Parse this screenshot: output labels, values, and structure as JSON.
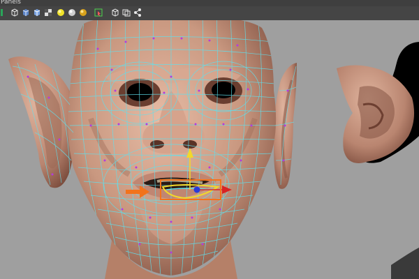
{
  "menu": {
    "panels_label": "Panels"
  },
  "toolbar": {
    "icons": [
      "camera-icon",
      "wireframe-shading-icon",
      "smooth-shading-icon",
      "textured-shading-icon",
      "default-light-icon",
      "all-lights-icon",
      "shadows-icon",
      "isolate-select-icon",
      "xray-icon",
      "grid-icon",
      "share-icon"
    ]
  },
  "viewport": {
    "content": "3d-head-model-with-edit-wireframe",
    "selection": "lip-edge-loop",
    "colors": {
      "skin": "#c99880",
      "skin_shadow": "#8a5a4a",
      "wire_cyan": "#5fe0ee",
      "wire_purple": "#b33be0",
      "annotation_orange": "#f2731c",
      "manip_yellow": "#f2d82a",
      "manip_blue": "#2a3bd8",
      "manip_red": "#d92323"
    }
  }
}
